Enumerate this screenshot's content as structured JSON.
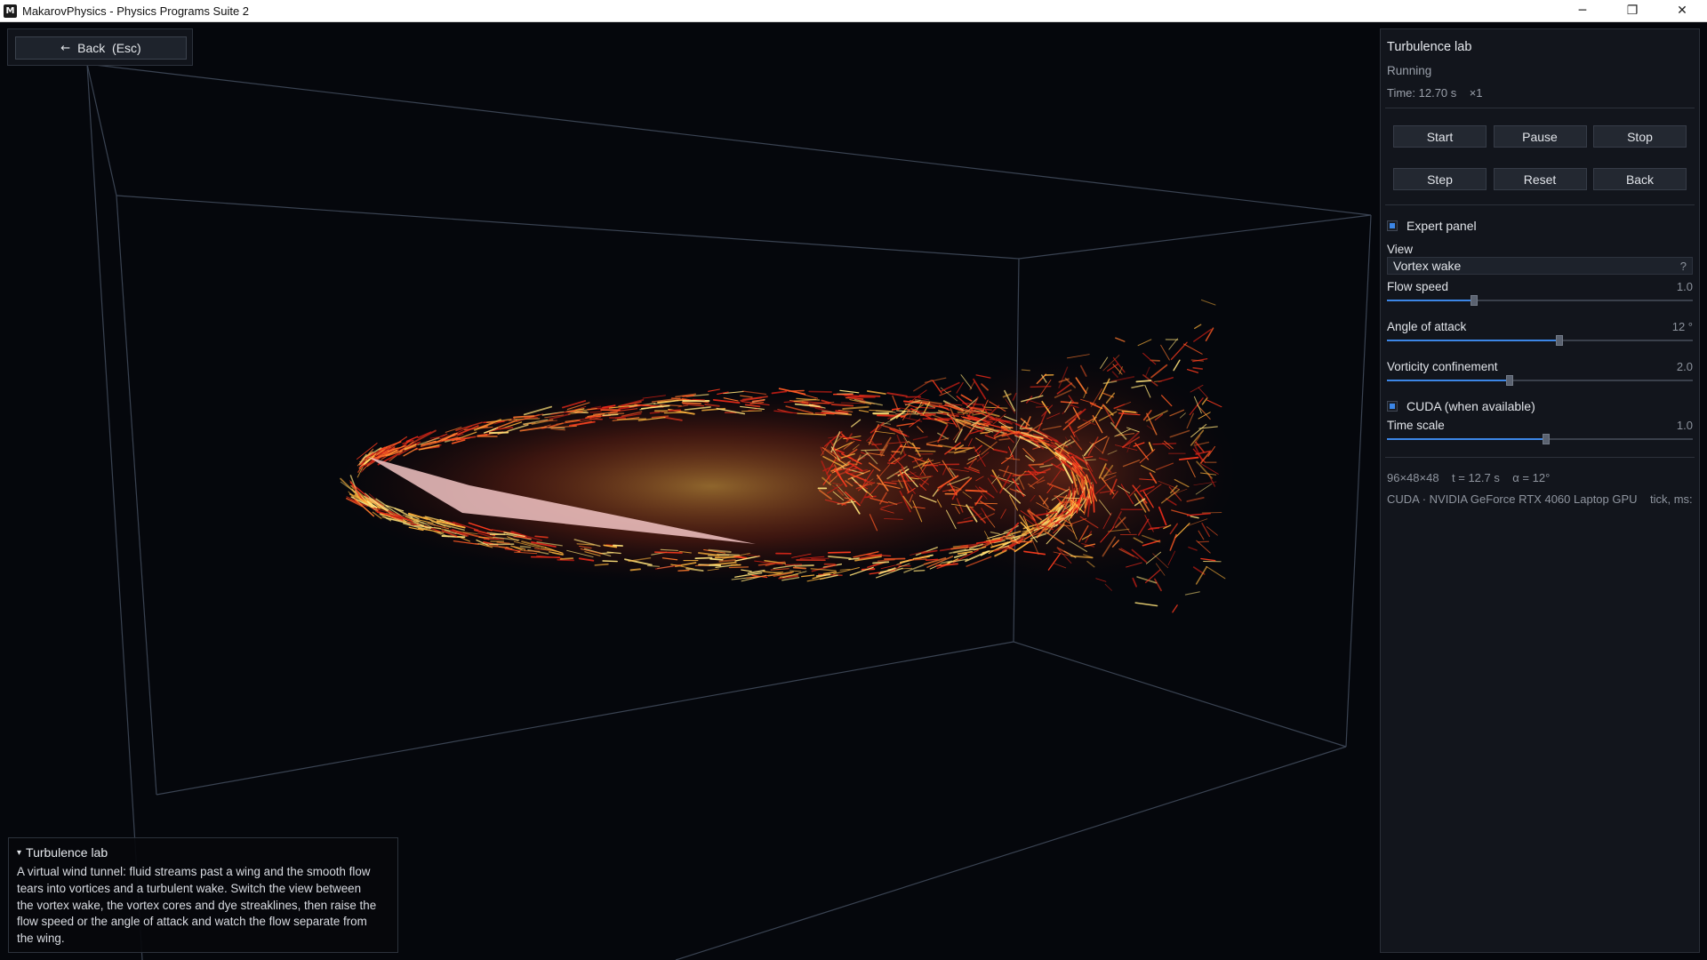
{
  "window": {
    "app_icon": "M",
    "title": "MakarovPhysics - Physics Programs Suite 2",
    "controls": {
      "minimize": "─",
      "restore": "❐",
      "close": "✕"
    }
  },
  "back_button": {
    "arrow": "←",
    "label": "Back  (Esc)"
  },
  "info_box": {
    "toggle": "▾",
    "title": "Turbulence lab",
    "lines": [
      "A virtual wind tunnel: fluid streams past a wing and the smooth flow",
      "tears into vortices and a turbulent wake. Switch the view between",
      "the vortex wake, the vortex cores and dye streaklines, then raise the",
      "flow speed or the angle of attack and watch the flow separate from",
      "the wing."
    ]
  },
  "panel": {
    "title": "Turbulence lab",
    "status": "Running",
    "time": "Time: 12.70 s    ×1",
    "buttons_row1": [
      "Start",
      "Pause",
      "Stop"
    ],
    "buttons_row2": [
      "Step",
      "Reset",
      "Back"
    ],
    "expert_panel": {
      "label": "Expert panel",
      "checked": true
    },
    "view": {
      "label": "View",
      "value": "Vortex wake",
      "help": "?"
    },
    "sliders": [
      {
        "key": "flow",
        "label": "Flow speed",
        "value_text": "1.0",
        "fraction": 0.285
      },
      {
        "key": "angle",
        "label": "Angle of attack",
        "value_text": "12 °",
        "fraction": 0.565
      },
      {
        "key": "vort",
        "label": "Vorticity confinement",
        "value_text": "2.0",
        "fraction": 0.4
      }
    ],
    "cuda": {
      "label": "CUDA (when available)",
      "checked": true
    },
    "time_scale": {
      "label": "Time scale",
      "value_text": "1.0",
      "fraction": 0.52
    },
    "grid_info": "96×48×48    t = 12.7 s    α = 12°",
    "gpu_info": "CUDA · NVIDIA GeForce RTX 4060 Laptop GPU    tick, ms:"
  },
  "colors": {
    "background": "#05070c",
    "panel": "#12151c",
    "accent": "#3c86e6",
    "box_lines": "#3a4352",
    "wing": "#f2c4c4"
  },
  "icons": {
    "back": "arrow-left-icon",
    "info_toggle": "triangle-down-icon",
    "check": "checkbox-icon",
    "help": "question-icon"
  }
}
